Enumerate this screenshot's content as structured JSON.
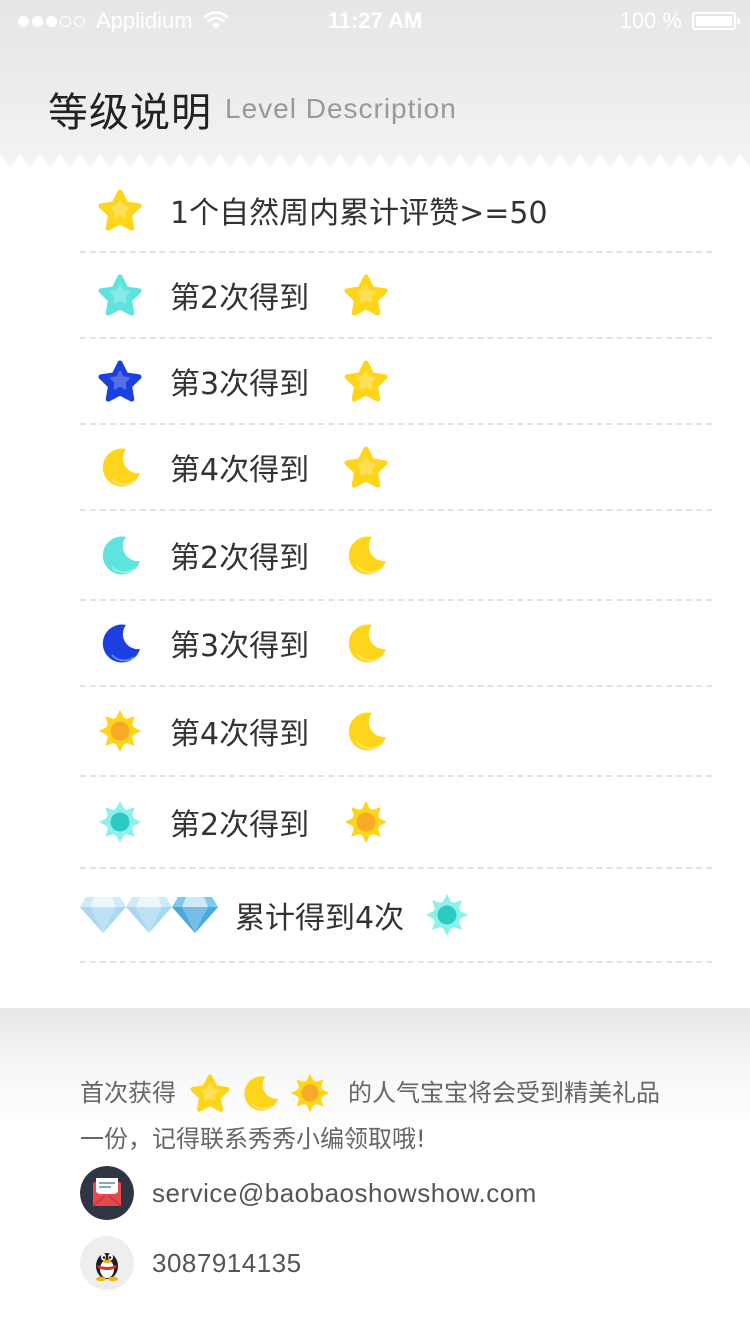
{
  "status_bar": {
    "carrier": "Applidium",
    "time": "11:27 AM",
    "battery": "100 %"
  },
  "header": {
    "title_zh": "等级说明",
    "title_en": "Level Description"
  },
  "levels": [
    {
      "icon": "star-yellow-icon",
      "text": "1个自然周内累计评赞>=50",
      "trail": ""
    },
    {
      "icon": "star-cyan-icon",
      "text": "第2次得到",
      "trail": "star-yellow-icon"
    },
    {
      "icon": "star-blue-icon",
      "text": "第3次得到",
      "trail": "star-yellow-icon"
    },
    {
      "icon": "moon-yellow-icon",
      "text": "第4次得到",
      "trail": "star-yellow-icon"
    },
    {
      "icon": "moon-cyan-icon",
      "text": "第2次得到",
      "trail": "moon-yellow-icon"
    },
    {
      "icon": "moon-blue-icon",
      "text": "第3次得到",
      "trail": "moon-yellow-icon"
    },
    {
      "icon": "sun-yellow-icon",
      "text": "第4次得到",
      "trail": "moon-yellow-icon"
    },
    {
      "icon": "sun-cyan-icon",
      "text": "第2次得到",
      "trail": "sun-yellow-icon"
    }
  ],
  "diamond_row": {
    "icons": [
      "diamond-light-icon",
      "diamond-light-icon",
      "diamond-blue-icon"
    ],
    "text": "累计得到4次",
    "trail": "sun-cyan-icon"
  },
  "footer": {
    "note_prefix": "首次获得",
    "note_icons": [
      "star-yellow-icon",
      "moon-yellow-icon",
      "sun-yellow-icon"
    ],
    "note_suffix": "的人气宝宝将会受到精美礼品",
    "note_line2": "一份，记得联系秀秀小编领取哦!",
    "email": "service@baobaoshowshow.com",
    "qq": "3087914135"
  },
  "colors": {
    "yellow": "#ffd51c",
    "cyan": "#5ee3dd",
    "blue": "#1b3fe0",
    "sun_core": "#f7a928",
    "text": "#333333",
    "muted": "#666666"
  }
}
